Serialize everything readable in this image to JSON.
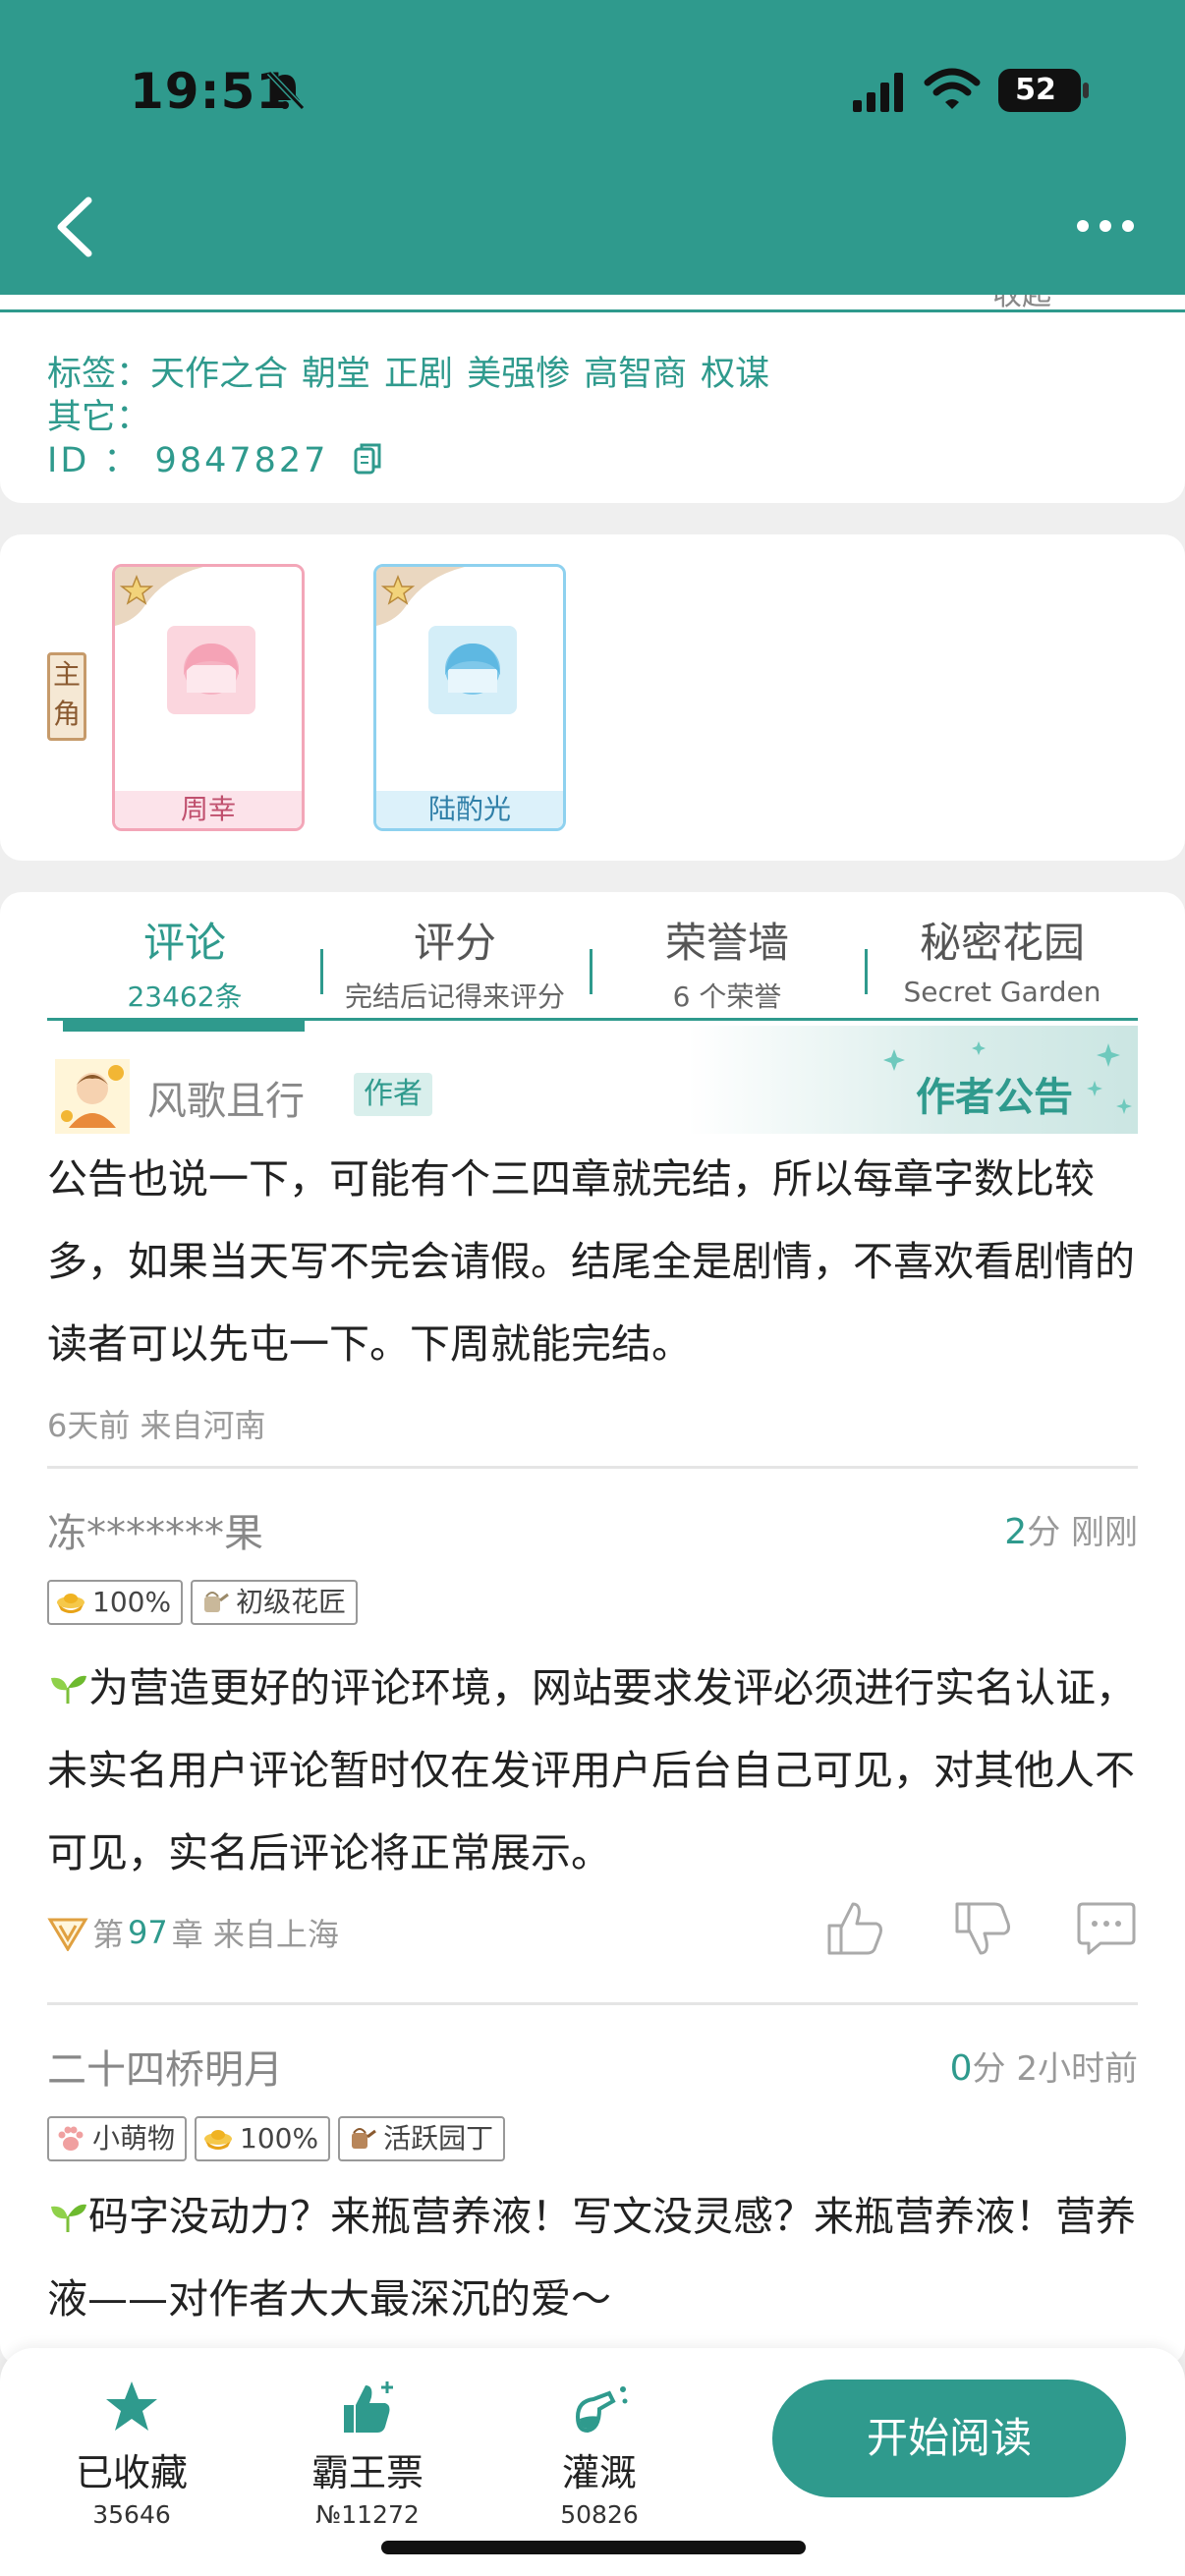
{
  "status": {
    "time": "19:51",
    "battery": "52",
    "battery_level": 0.52
  },
  "nav": {
    "back_icon": "chevron-left-icon",
    "more_icon": "ellipsis-icon"
  },
  "info": {
    "collapse": "收起",
    "tags_label": "标签：",
    "tags": [
      "天作之合",
      "朝堂",
      "正剧",
      "美强惨",
      "高智商",
      "权谋"
    ],
    "other_label": "其它：",
    "id_label": "ID ：",
    "id_value": "9847827"
  },
  "characters": {
    "role_label": "主角",
    "list": [
      {
        "name": "周幸",
        "color": "#f3a6b8"
      },
      {
        "name": "陆酌光",
        "color": "#8ed1ef"
      }
    ]
  },
  "tabs": [
    {
      "title": "评论",
      "sub": "23462条"
    },
    {
      "title": "评分",
      "sub": "完结后记得来评分"
    },
    {
      "title": "荣誉墙",
      "sub": "6 个荣誉"
    },
    {
      "title": "秘密花园",
      "sub": "Secret Garden"
    }
  ],
  "notice": {
    "username": "风歌且行",
    "author_badge": "作者",
    "title": "作者公告",
    "text": "公告也说一下，可能有个三四章就完结，所以每章字数比较多，如果当天写不完会请假。结尾全是剧情，不喜欢看剧情的读者可以先屯一下。下周就能完结。",
    "meta": "6天前  来自河南"
  },
  "comments": [
    {
      "username": "冻*******果",
      "score": "2",
      "score_unit": "分",
      "time": "刚刚",
      "badges": [
        {
          "label": "100%",
          "icon": "gold-ingot-icon"
        },
        {
          "label": "初级花匠",
          "icon": "watering-can-icon"
        }
      ],
      "text": "为营造更好的评论环境，网站要求发评必须进行实名认证，未实名用户评论暂时仅在发评用户后台自己可见，对其他人不可见，实名后评论将正常展示。",
      "chapter_prefix": "第",
      "chapter": "97",
      "chapter_suffix": "章 来自上海"
    },
    {
      "username": "二十四桥明月",
      "score": "0",
      "score_unit": "分",
      "time": "2小时前",
      "badges": [
        {
          "label": "小萌物",
          "icon": "paw-icon"
        },
        {
          "label": "100%",
          "icon": "gold-ingot-icon"
        },
        {
          "label": "活跃园丁",
          "icon": "watering-can-icon"
        }
      ],
      "text": "码字没动力？来瓶营养液！写文没灵感？来瓶营养液！营养液——对作者大大最深沉的爱～"
    }
  ],
  "bottom": {
    "collect_label": "已收藏",
    "collect_count": "35646",
    "vote_label": "霸王票",
    "vote_count": "№11272",
    "water_label": "灌溉",
    "water_count": "50826",
    "read_button": "开始阅读"
  },
  "colors": {
    "accent": "#2f9a8d"
  }
}
